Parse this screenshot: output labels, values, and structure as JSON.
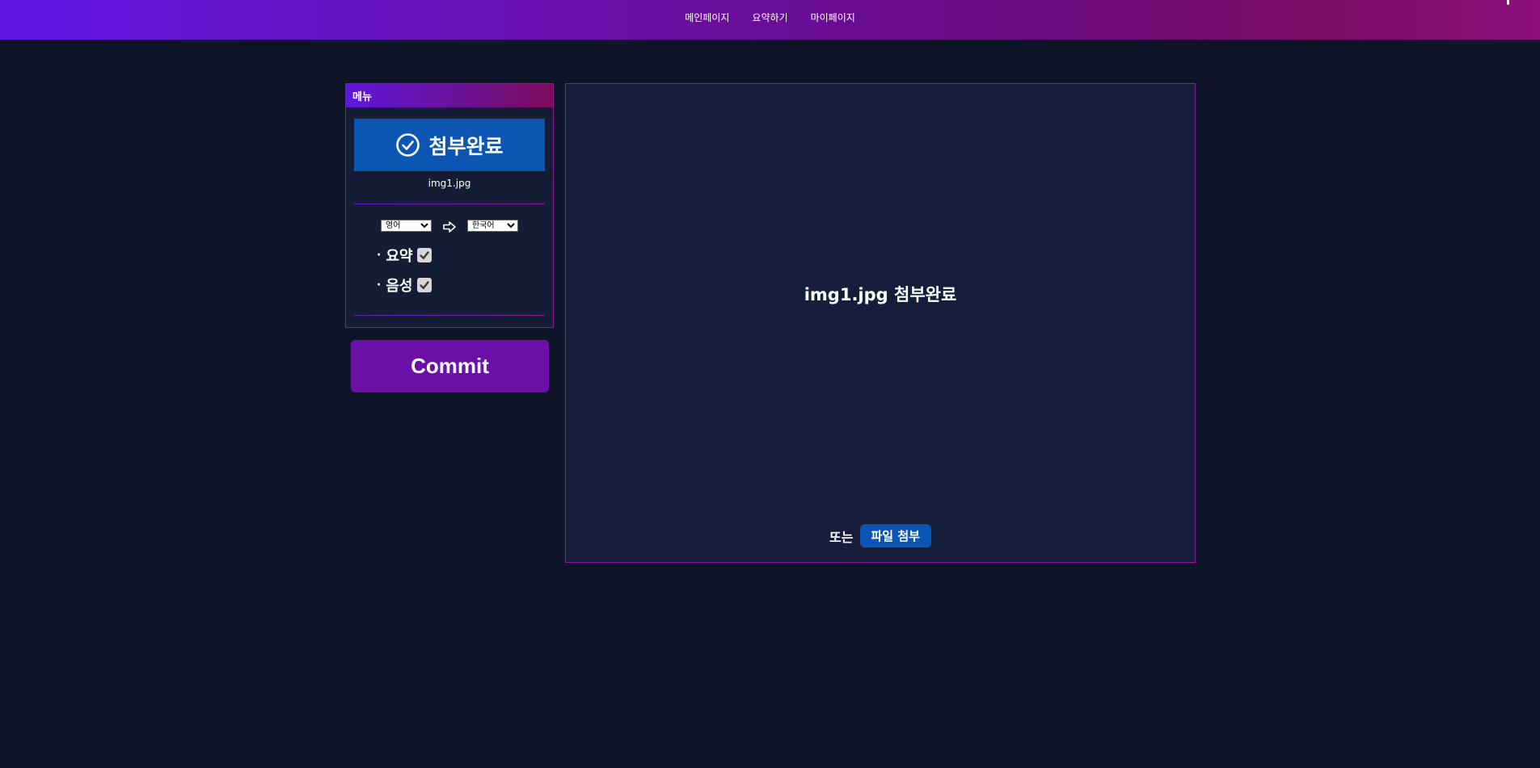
{
  "nav": {
    "items": [
      "메인페이지",
      "요약하기",
      "마이페이지"
    ]
  },
  "menu": {
    "header": "메뉴",
    "attach_status": "첨부완료",
    "filename": "img1.jpg",
    "source_lang": "영어",
    "target_lang": "한국어",
    "options": [
      {
        "label": "요약",
        "checked": true
      },
      {
        "label": "음성",
        "checked": true
      }
    ],
    "bullet": "·"
  },
  "commit": {
    "label": "Commit"
  },
  "drop": {
    "message": "img1.jpg 첨부완료",
    "or_label": "또는",
    "attach_button": "파일 첨부"
  },
  "colors": {
    "background": "#0f1428",
    "accent_purple": "#6a0fa8",
    "accent_blue": "#0c56b3",
    "border": "#8a1a8e"
  },
  "icons": {
    "status": "check-circle-icon",
    "lang_arrow": "arrow-right-icon",
    "checkbox": "checkmark-icon"
  }
}
